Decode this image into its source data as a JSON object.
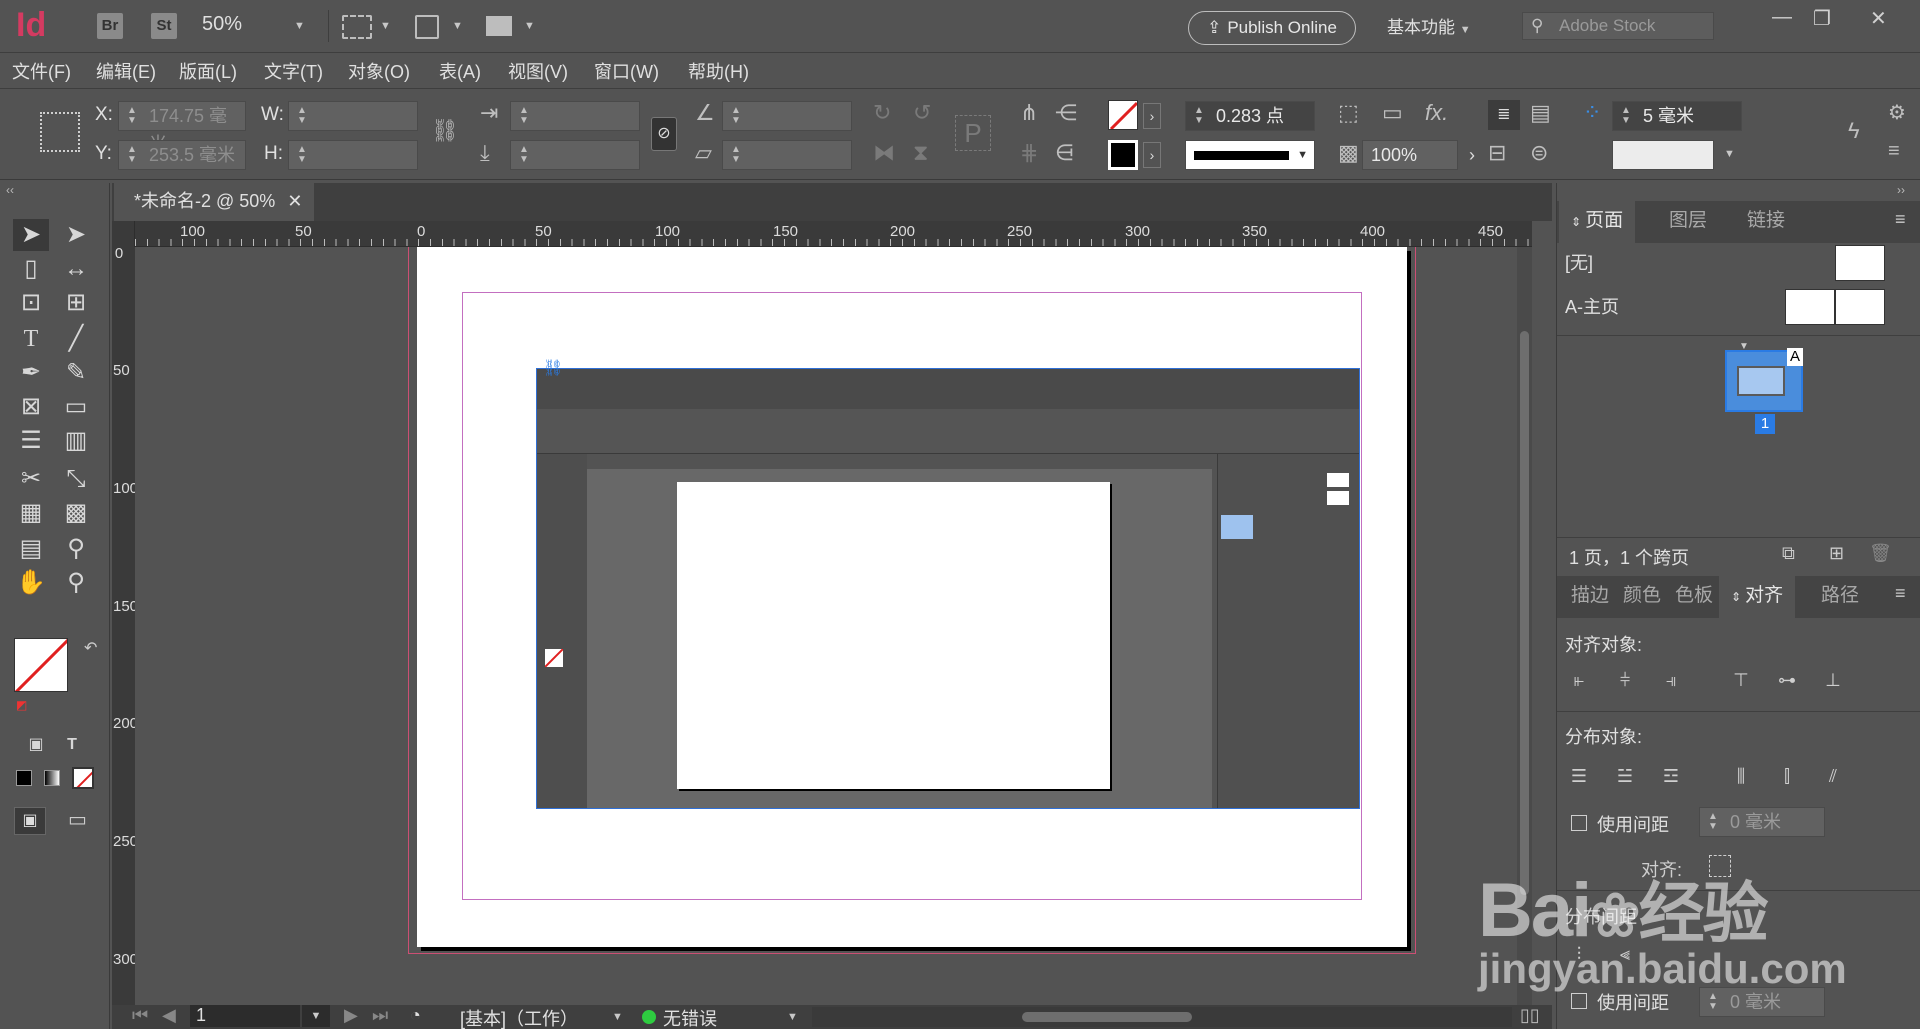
{
  "app": {
    "logo": "Id",
    "bridge_badge": "Br",
    "stock_badge": "St",
    "zoom": "50%",
    "publish_label": "Publish Online",
    "workspace_label": "基本功能",
    "stock_search_placeholder": "Adobe Stock"
  },
  "menus": [
    "文件(F)",
    "编辑(E)",
    "版面(L)",
    "文字(T)",
    "对象(O)",
    "表(A)",
    "视图(V)",
    "窗口(W)",
    "帮助(H)"
  ],
  "control": {
    "x_label": "X:",
    "x_value": "174.75 毫米",
    "y_label": "Y:",
    "y_value": "253.5 毫米",
    "w_label": "W:",
    "h_label": "H:",
    "stroke_weight": "0.283 点",
    "opacity": "100%",
    "gap_value": "5 毫米"
  },
  "document": {
    "tab_title": "*未命名-2 @ 50%",
    "ruler_h": [
      "100",
      "50",
      "0",
      "50",
      "100",
      "150",
      "200",
      "250",
      "300",
      "350",
      "400",
      "450"
    ],
    "ruler_v": [
      "0",
      "50",
      "100",
      "150",
      "200",
      "250",
      "300"
    ]
  },
  "panels": {
    "tabs_top": [
      "页面",
      "图层",
      "链接"
    ],
    "none_label": "[无]",
    "master_label": "A-主页",
    "master_letter": "A",
    "page_number": "1",
    "pages_status": "1 页，1 个跨页",
    "tabs_bottom": [
      "描边",
      "颜色",
      "色板",
      "对齐",
      "路径"
    ],
    "align_objects": "对齐对象:",
    "distribute_objects": "分布对象:",
    "use_spacing": "使用间距",
    "spacing_value": "0 毫米",
    "align_to": "对齐:",
    "distribute_spacing": "分布间距",
    "use_spacing_2": "使用间距",
    "spacing_value_2": "0 毫米"
  },
  "status": {
    "page_field": "1",
    "preflight_profile": "[基本]（工作）",
    "errors": "无错误"
  },
  "watermark": {
    "brand": "Bai",
    "brand_suffix": "经验",
    "url": "jingyan.baidu.com"
  },
  "colors": {
    "chrome": "#535353",
    "ruler": "#3a3a3a",
    "accent_blue": "#2a7be4",
    "bleed_guide": "#cc4f74",
    "margin_guide": "#c36fc0",
    "status_ok": "#2ecc40"
  }
}
